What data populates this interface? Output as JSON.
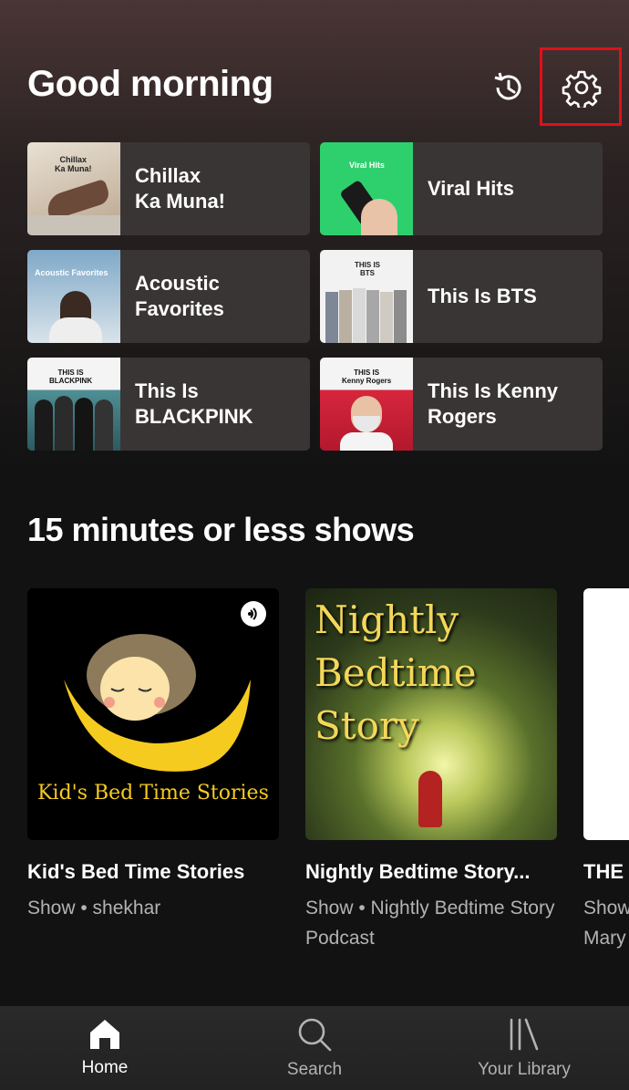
{
  "header": {
    "greeting": "Good morning"
  },
  "recent_tiles": [
    {
      "label": "Chillax\nKa Muna!",
      "art_text": "Chillax\nKa Muna!"
    },
    {
      "label": "Viral Hits",
      "art_text": "Viral Hits"
    },
    {
      "label": "Acoustic\nFavorites",
      "art_text": "Acoustic Favorites"
    },
    {
      "label": "This Is BTS",
      "art_text": "THIS IS\nBTS"
    },
    {
      "label": "This Is\nBLACKPINK",
      "art_text": "THIS IS\nBLACKPINK"
    },
    {
      "label": "This Is Kenny\nRogers",
      "art_text": "THIS IS\nKenny Rogers"
    }
  ],
  "section": {
    "title": "15 minutes or less shows",
    "cards": [
      {
        "title": "Kid's Bed Time Stories",
        "subtitle": "Show • shekhar",
        "art_text": "Kid's Bed Time Stories"
      },
      {
        "title": "Nightly Bedtime Story...",
        "subtitle": "Show • Nightly Bedtime Story Podcast",
        "art_text": "Nightly Bedtime Story"
      },
      {
        "title": "THE",
        "subtitle": "Show Mary"
      }
    ]
  },
  "nav": {
    "items": [
      {
        "label": "Home",
        "icon": "home-icon"
      },
      {
        "label": "Search",
        "icon": "search-icon"
      },
      {
        "label": "Your Library",
        "icon": "library-icon"
      }
    ]
  },
  "colors": {
    "accent": "#1db954",
    "highlight": "#e0101a",
    "background": "#121212"
  }
}
